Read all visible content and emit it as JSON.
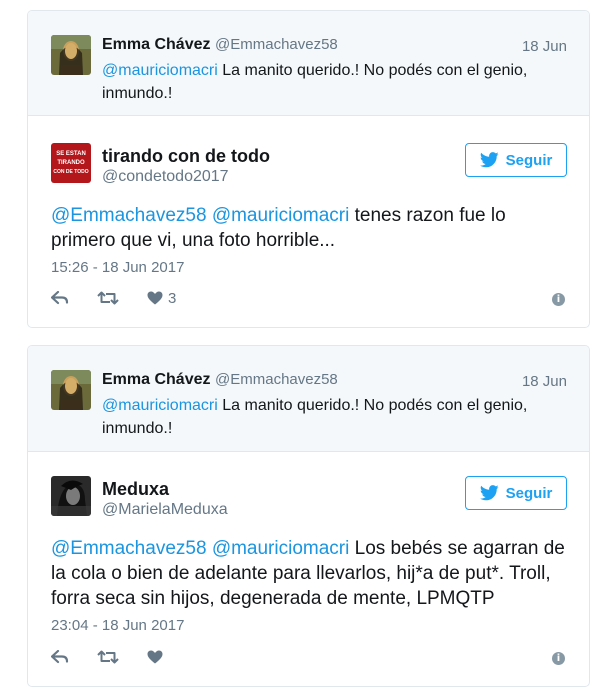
{
  "tweets": [
    {
      "quoted": {
        "name": "Emma Chávez",
        "handle": "@Emmachavez58",
        "date": "18 Jun",
        "mention": "@mauriciomacri",
        "text": " La manito querido.! No podés con el genio, inmundo.!",
        "avatar_icon": "mona-lisa-avatar"
      },
      "reply": {
        "name": "tirando con de todo",
        "handle": "@condetodo2017",
        "avatar_icon": "se-estan-tirando-con-de-todo-logo",
        "avatar_text": [
          "SE ESTAN",
          "TIRANDO",
          "CON DE TODO"
        ],
        "follow_label": "Seguir",
        "mention1": "@Emmachavez58",
        "mention2": "@mauriciomacri",
        "text": " tenes razon fue lo primero que vi, una foto horrible...",
        "timestamp": "15:26 - 18 Jun 2017",
        "like_count": "3"
      }
    },
    {
      "quoted": {
        "name": "Emma Chávez",
        "handle": "@Emmachavez58",
        "date": "18 Jun",
        "mention": "@mauriciomacri",
        "text": " La manito querido.! No podés con el genio, inmundo.!",
        "avatar_icon": "mona-lisa-avatar"
      },
      "reply": {
        "name": "Meduxa",
        "handle": "@MarielaMeduxa",
        "avatar_icon": "dark-portrait-avatar",
        "follow_label": "Seguir",
        "mention1": "@Emmachavez58",
        "mention2": "@mauriciomacri",
        "text": " Los bebés se agarran de la cola o bien de adelante para llevarlos, hij*a de put*. Troll, forra seca sin hijos, degenerada de mente, LPMQTP",
        "timestamp": "23:04 - 18 Jun 2017",
        "like_count": ""
      }
    }
  ],
  "colors": {
    "accent": "#1da1f2",
    "mention": "#1b95e0",
    "muted": "#657786",
    "quoted_bg": "#f5f8fa",
    "border": "#e1e8ed"
  }
}
